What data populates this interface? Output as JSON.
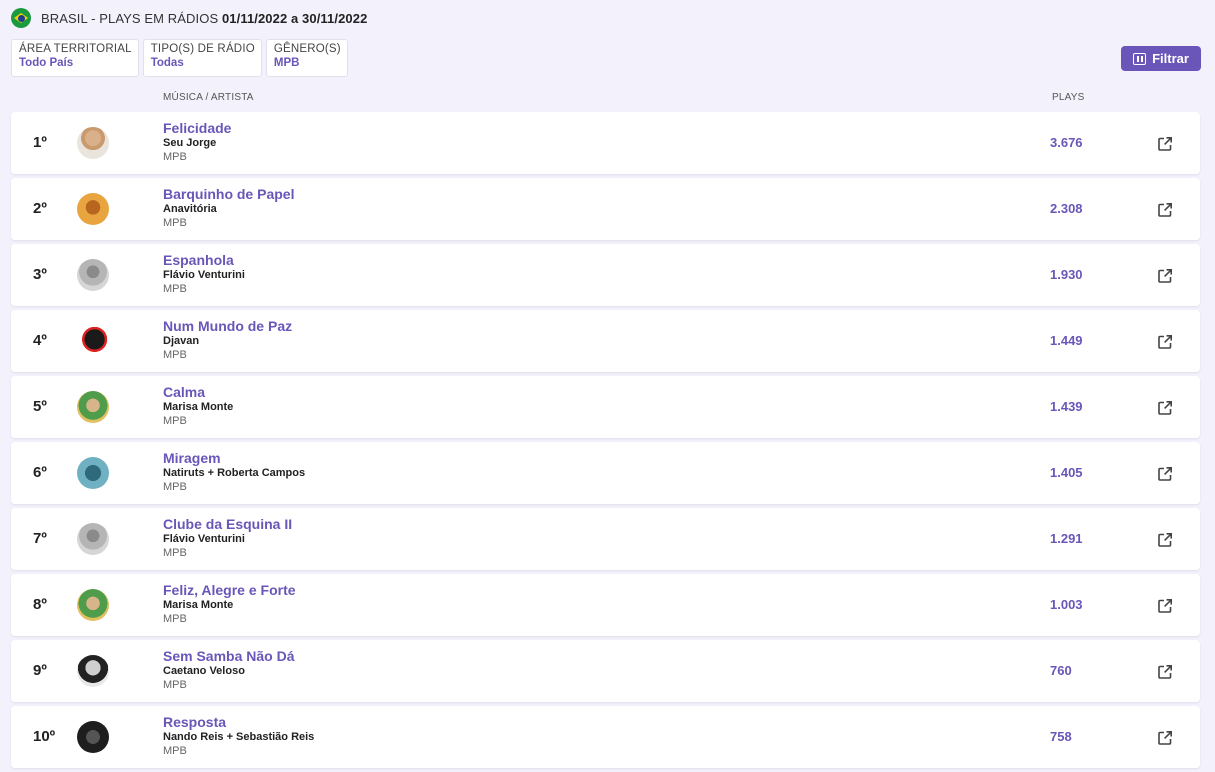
{
  "header": {
    "title_prefix": "BRASIL - PLAYS EM RÁDIOS",
    "title_range": "01/11/2022 a 30/11/2022",
    "flag_icon": "brazil-flag-icon"
  },
  "filters": [
    {
      "label": "ÁREA TERRITORIAL",
      "value": "Todo País"
    },
    {
      "label": "TIPO(S) DE RÁDIO",
      "value": "Todas"
    },
    {
      "label": "GÊNERO(S)",
      "value": "MPB"
    }
  ],
  "filter_button": {
    "label": "Filtrar",
    "icon": "sliders-icon"
  },
  "columns": {
    "music": "MÚSICA / ARTISTA",
    "plays": "PLAYS"
  },
  "accent_color": "#6a56b8",
  "rows": [
    {
      "rank": "1º",
      "song": "Felicidade",
      "artist": "Seu Jorge",
      "genre": "MPB",
      "plays": "3.676"
    },
    {
      "rank": "2º",
      "song": "Barquinho de Papel",
      "artist": "Anavitória",
      "genre": "MPB",
      "plays": "2.308"
    },
    {
      "rank": "3º",
      "song": "Espanhola",
      "artist": "Flávio Venturini",
      "genre": "MPB",
      "plays": "1.930"
    },
    {
      "rank": "4º",
      "song": "Num Mundo de Paz",
      "artist": "Djavan",
      "genre": "MPB",
      "plays": "1.449"
    },
    {
      "rank": "5º",
      "song": "Calma",
      "artist": "Marisa Monte",
      "genre": "MPB",
      "plays": "1.439"
    },
    {
      "rank": "6º",
      "song": "Miragem",
      "artist": "Natiruts + Roberta Campos",
      "genre": "MPB",
      "plays": "1.405"
    },
    {
      "rank": "7º",
      "song": "Clube da Esquina II",
      "artist": "Flávio Venturini",
      "genre": "MPB",
      "plays": "1.291"
    },
    {
      "rank": "8º",
      "song": "Feliz, Alegre e Forte",
      "artist": "Marisa Monte",
      "genre": "MPB",
      "plays": "1.003"
    },
    {
      "rank": "9º",
      "song": "Sem Samba Não Dá",
      "artist": "Caetano Veloso",
      "genre": "MPB",
      "plays": "760"
    },
    {
      "rank": "10º",
      "song": "Resposta",
      "artist": "Nando Reis + Sebastião Reis",
      "genre": "MPB",
      "plays": "758"
    }
  ]
}
